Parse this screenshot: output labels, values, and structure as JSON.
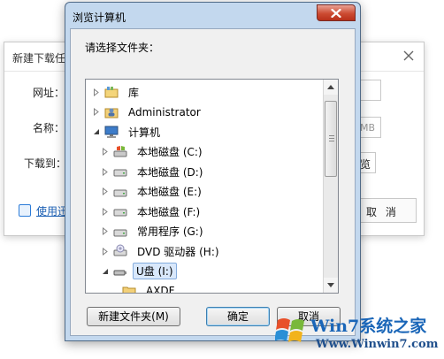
{
  "background_dialog": {
    "title": "新建下载任",
    "url_label": "网址：",
    "name_label": "名称：",
    "save_to_label": "下载到：",
    "size_unit": "MB",
    "browse_label": "览",
    "cancel_label": "取 消",
    "help_link": "使用迅"
  },
  "dialog": {
    "title": "浏览计算机",
    "prompt": "请选择文件夹：",
    "tree": [
      {
        "label": "库",
        "icon": "library-icon",
        "arrow": "collapsed",
        "level": 0
      },
      {
        "label": "Administrator",
        "icon": "user-folder-icon",
        "arrow": "collapsed",
        "level": 0
      },
      {
        "label": "计算机",
        "icon": "computer-icon",
        "arrow": "expanded",
        "level": 0
      },
      {
        "label": "本地磁盘 (C:)",
        "icon": "system-drive-icon",
        "arrow": "collapsed",
        "level": 1
      },
      {
        "label": "本地磁盘 (D:)",
        "icon": "hard-drive-icon",
        "arrow": "collapsed",
        "level": 1
      },
      {
        "label": "本地磁盘 (E:)",
        "icon": "hard-drive-icon",
        "arrow": "collapsed",
        "level": 1
      },
      {
        "label": "本地磁盘 (F:)",
        "icon": "hard-drive-icon",
        "arrow": "collapsed",
        "level": 1
      },
      {
        "label": "常用程序 (G:)",
        "icon": "hard-drive-icon",
        "arrow": "collapsed",
        "level": 1
      },
      {
        "label": "DVD 驱动器 (H:)",
        "icon": "dvd-drive-icon",
        "arrow": "collapsed",
        "level": 1
      },
      {
        "label": "U盘 (I:)",
        "icon": "usb-drive-icon",
        "arrow": "expanded",
        "level": 1,
        "selected": true
      },
      {
        "label": "AXDF",
        "icon": "folder-icon",
        "arrow": "none",
        "level": 2
      }
    ],
    "new_folder_button": "新建文件夹(M)",
    "ok_button": "确定",
    "cancel_button": "取消"
  },
  "watermark": {
    "brand": "Win7系统之家",
    "url": "Www.Winwin7.com"
  },
  "colors": {
    "dialog_frame": "#c3d8ee",
    "close_button": "#cc4b32",
    "selection": "#d9e8fb",
    "watermark_text": "#1a66b8"
  }
}
